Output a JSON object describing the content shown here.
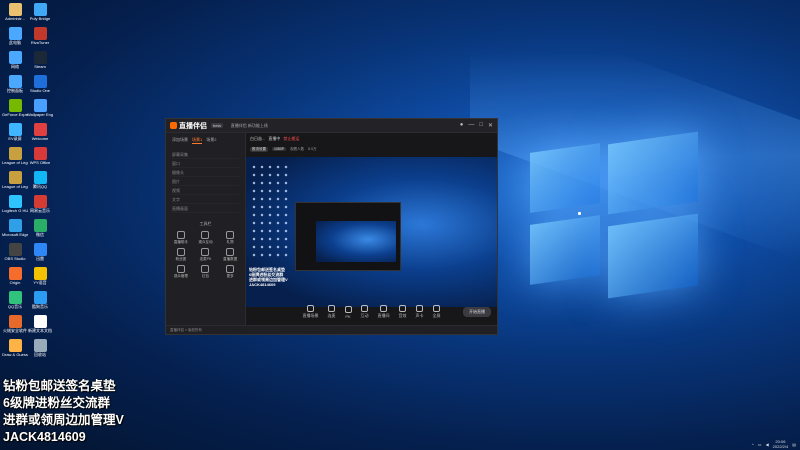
{
  "desktop": {
    "icons": [
      {
        "label": "Administr...",
        "color": "#e8c070"
      },
      {
        "label": "此电脑",
        "color": "#4aa8ff"
      },
      {
        "label": "网络",
        "color": "#4aa8ff"
      },
      {
        "label": "控制面板",
        "color": "#4aa8ff"
      },
      {
        "label": "GeForce Experience",
        "color": "#76b900"
      },
      {
        "label": "EV录屏",
        "color": "#3fb5ff"
      },
      {
        "label": "League of Legends",
        "color": "#c8a040"
      },
      {
        "label": "League of Legends",
        "color": "#c8a040"
      },
      {
        "label": "Logitech G HUB",
        "color": "#2ec5ff"
      },
      {
        "label": "Microsoft Edge",
        "color": "#2fa0e8"
      },
      {
        "label": "OBS Studio",
        "color": "#444444"
      },
      {
        "label": "Origin",
        "color": "#f56c2d"
      },
      {
        "label": "QQ音乐",
        "color": "#31c27c"
      },
      {
        "label": "火绒安全软件",
        "color": "#e86a2a"
      },
      {
        "label": "Draw & Guess",
        "color": "#ffb347"
      },
      {
        "label": "Poly Bridge",
        "color": "#3fa9f5"
      },
      {
        "label": "RivaTuner",
        "color": "#c0392b"
      },
      {
        "label": "Steam",
        "color": "#1b2838"
      },
      {
        "label": "Studio One",
        "color": "#1e6fd9"
      },
      {
        "label": "Wallpaper Engine",
        "color": "#4aa0ff"
      },
      {
        "label": "Welcome",
        "color": "#e04040"
      },
      {
        "label": "WPS Office",
        "color": "#d83a3a"
      },
      {
        "label": "腾讯QQ",
        "color": "#12b7f5"
      },
      {
        "label": "网易云音乐",
        "color": "#d43c33"
      },
      {
        "label": "微信",
        "color": "#2aae67"
      },
      {
        "label": "迅雷",
        "color": "#2f86f6"
      },
      {
        "label": "YY语音",
        "color": "#f2c100"
      },
      {
        "label": "酷狗音乐",
        "color": "#2c9cf2"
      },
      {
        "label": "新建文本文档",
        "color": "#ffffff"
      },
      {
        "label": "回收站",
        "color": "#9ab"
      }
    ]
  },
  "app": {
    "brand": "直播伴侣",
    "version": "beta",
    "notice": "直播伴侣 新功能上线",
    "tabs": [
      "添加场景",
      "场景1",
      "场景2"
    ],
    "scenes": [
      "屏幕采集",
      "窗口",
      "摄像头",
      "图片",
      "视频",
      "文字",
      "直播画面"
    ],
    "tools_title": "工具栏",
    "tools": [
      "直播助手",
      "观众互动",
      "礼物",
      "粉丝团",
      "连麦PK",
      "直播数据",
      "观众管理",
      "红包",
      "更多"
    ],
    "room": {
      "name": "白日苗...",
      "status": "直播中",
      "live_tag": "禁止搬运"
    },
    "sub_items": [
      "推流设置",
      "1080P",
      "观看人数",
      "8.9万"
    ],
    "controls": [
      "直播场景",
      "连麦",
      "PK",
      "互动",
      "直播间",
      "音效",
      "声卡",
      "全屏"
    ],
    "start_button": "开始直播",
    "footer": "直播伴侣 × 版权所有",
    "preview_overlay": [
      "钻粉包邮送签名桌垫",
      "6级牌进粉丝交流群",
      "进群或领周边加管理V",
      "JACK4814609"
    ]
  },
  "overlay_text": {
    "line1": "钻粉包邮送签名桌垫",
    "line2": "6级牌进粉丝交流群",
    "line3": "进群或领周边加管理V",
    "line4": "JACK4814609"
  },
  "tray": {
    "time": "20:06",
    "date": "2022/2/4"
  }
}
